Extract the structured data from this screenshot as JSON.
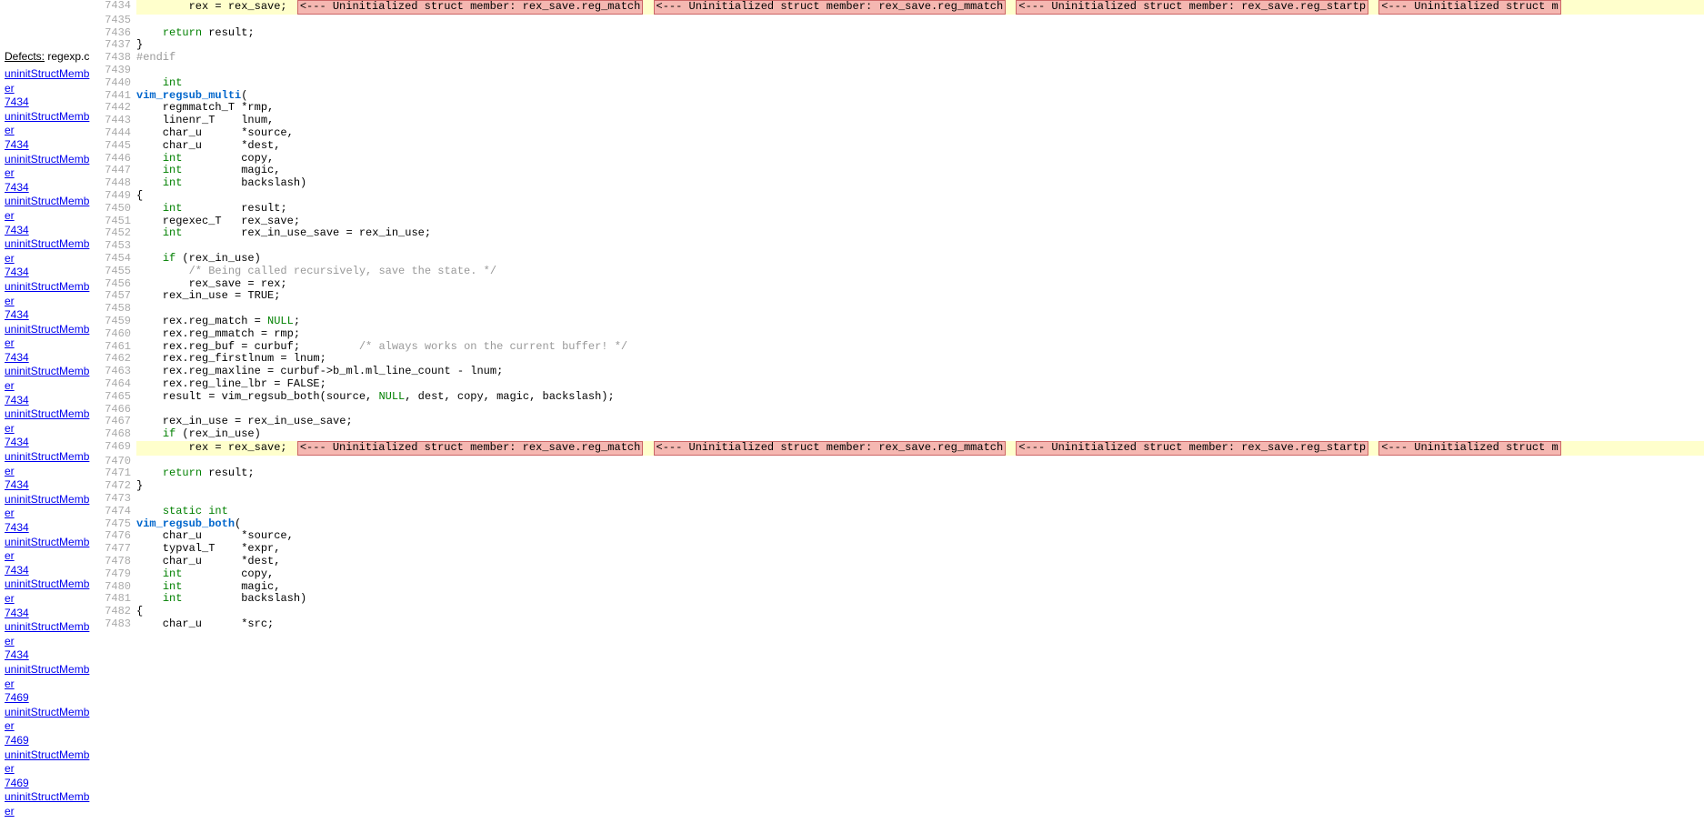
{
  "sidebar": {
    "title_label": "Defects:",
    "title_file": "regexp.c",
    "defects": [
      {
        "name": "uninitStructMember",
        "line": "7434"
      },
      {
        "name": "uninitStructMember",
        "line": "7434"
      },
      {
        "name": "uninitStructMember",
        "line": "7434"
      },
      {
        "name": "uninitStructMember",
        "line": "7434"
      },
      {
        "name": "uninitStructMember",
        "line": "7434"
      },
      {
        "name": "uninitStructMember",
        "line": "7434"
      },
      {
        "name": "uninitStructMember",
        "line": "7434"
      },
      {
        "name": "uninitStructMember",
        "line": "7434"
      },
      {
        "name": "uninitStructMember",
        "line": "7434"
      },
      {
        "name": "uninitStructMember",
        "line": "7434"
      },
      {
        "name": "uninitStructMember",
        "line": "7434"
      },
      {
        "name": "uninitStructMember",
        "line": "7434"
      },
      {
        "name": "uninitStructMember",
        "line": "7434"
      },
      {
        "name": "uninitStructMember",
        "line": "7434"
      },
      {
        "name": "uninitStructMember",
        "line": "7469"
      },
      {
        "name": "uninitStructMember",
        "line": "7469"
      },
      {
        "name": "uninitStructMember",
        "line": "7469"
      },
      {
        "name": "uninitStructMember",
        "line": ""
      }
    ]
  },
  "warnings": {
    "w1": "<--- Uninitialized struct member: rex_save.reg_match",
    "w2": "<--- Uninitialized struct member: rex_save.reg_mmatch",
    "w3": "<--- Uninitialized struct member: rex_save.reg_startp",
    "w4": "<--- Uninitialized struct m"
  },
  "lines": [
    {
      "n": "7434",
      "hl": true,
      "warn": true,
      "tokens": [
        {
          "t": "        rex = rex_save;"
        }
      ]
    },
    {
      "n": "7435",
      "tokens": []
    },
    {
      "n": "7436",
      "tokens": [
        {
          "t": "    "
        },
        {
          "t": "return",
          "c": "kw"
        },
        {
          "t": " result;"
        }
      ]
    },
    {
      "n": "7437",
      "tokens": [
        {
          "t": "}"
        }
      ]
    },
    {
      "n": "7438",
      "tokens": [
        {
          "t": "#endif",
          "c": "pp"
        }
      ]
    },
    {
      "n": "7439",
      "tokens": []
    },
    {
      "n": "7440",
      "tokens": [
        {
          "t": "    "
        },
        {
          "t": "int",
          "c": "kw"
        }
      ]
    },
    {
      "n": "7441",
      "tokens": [
        {
          "t": "vim_regsub_multi",
          "c": "fn"
        },
        {
          "t": "("
        }
      ]
    },
    {
      "n": "7442",
      "tokens": [
        {
          "t": "    regmmatch_T *rmp,"
        }
      ]
    },
    {
      "n": "7443",
      "tokens": [
        {
          "t": "    linenr_T    lnum,"
        }
      ]
    },
    {
      "n": "7444",
      "tokens": [
        {
          "t": "    char_u      *source,"
        }
      ]
    },
    {
      "n": "7445",
      "tokens": [
        {
          "t": "    char_u      *dest,"
        }
      ]
    },
    {
      "n": "7446",
      "tokens": [
        {
          "t": "    "
        },
        {
          "t": "int",
          "c": "kw"
        },
        {
          "t": "         copy,"
        }
      ]
    },
    {
      "n": "7447",
      "tokens": [
        {
          "t": "    "
        },
        {
          "t": "int",
          "c": "kw"
        },
        {
          "t": "         magic,"
        }
      ]
    },
    {
      "n": "7448",
      "tokens": [
        {
          "t": "    "
        },
        {
          "t": "int",
          "c": "kw"
        },
        {
          "t": "         backslash)"
        }
      ]
    },
    {
      "n": "7449",
      "tokens": [
        {
          "t": "{"
        }
      ]
    },
    {
      "n": "7450",
      "tokens": [
        {
          "t": "    "
        },
        {
          "t": "int",
          "c": "kw"
        },
        {
          "t": "         result;"
        }
      ]
    },
    {
      "n": "7451",
      "tokens": [
        {
          "t": "    regexec_T   rex_save;"
        }
      ]
    },
    {
      "n": "7452",
      "tokens": [
        {
          "t": "    "
        },
        {
          "t": "int",
          "c": "kw"
        },
        {
          "t": "         rex_in_use_save = rex_in_use;"
        }
      ]
    },
    {
      "n": "7453",
      "tokens": []
    },
    {
      "n": "7454",
      "tokens": [
        {
          "t": "    "
        },
        {
          "t": "if",
          "c": "kw"
        },
        {
          "t": " (rex_in_use)"
        }
      ]
    },
    {
      "n": "7455",
      "tokens": [
        {
          "t": "        "
        },
        {
          "t": "/* Being called recursively, save the state. */",
          "c": "cmt"
        }
      ]
    },
    {
      "n": "7456",
      "tokens": [
        {
          "t": "        rex_save = rex;"
        }
      ]
    },
    {
      "n": "7457",
      "tokens": [
        {
          "t": "    rex_in_use = TRUE;"
        }
      ]
    },
    {
      "n": "7458",
      "tokens": []
    },
    {
      "n": "7459",
      "tokens": [
        {
          "t": "    rex.reg_match = "
        },
        {
          "t": "NULL",
          "c": "kw"
        },
        {
          "t": ";"
        }
      ]
    },
    {
      "n": "7460",
      "tokens": [
        {
          "t": "    rex.reg_mmatch = rmp;"
        }
      ]
    },
    {
      "n": "7461",
      "tokens": [
        {
          "t": "    rex.reg_buf = curbuf;         "
        },
        {
          "t": "/* always works on the current buffer! */",
          "c": "cmt"
        }
      ]
    },
    {
      "n": "7462",
      "tokens": [
        {
          "t": "    rex.reg_firstlnum = lnum;"
        }
      ]
    },
    {
      "n": "7463",
      "tokens": [
        {
          "t": "    rex.reg_maxline = curbuf->b_ml.ml_line_count - lnum;"
        }
      ]
    },
    {
      "n": "7464",
      "tokens": [
        {
          "t": "    rex.reg_line_lbr = FALSE;"
        }
      ]
    },
    {
      "n": "7465",
      "tokens": [
        {
          "t": "    result = vim_regsub_both(source, "
        },
        {
          "t": "NULL",
          "c": "kw"
        },
        {
          "t": ", dest, copy, magic, backslash);"
        }
      ]
    },
    {
      "n": "7466",
      "tokens": []
    },
    {
      "n": "7467",
      "tokens": [
        {
          "t": "    rex_in_use = rex_in_use_save;"
        }
      ]
    },
    {
      "n": "7468",
      "tokens": [
        {
          "t": "    "
        },
        {
          "t": "if",
          "c": "kw"
        },
        {
          "t": " (rex_in_use)"
        }
      ]
    },
    {
      "n": "7469",
      "hl": true,
      "warn": true,
      "tokens": [
        {
          "t": "        rex = rex_save;"
        }
      ]
    },
    {
      "n": "7470",
      "tokens": []
    },
    {
      "n": "7471",
      "tokens": [
        {
          "t": "    "
        },
        {
          "t": "return",
          "c": "kw"
        },
        {
          "t": " result;"
        }
      ]
    },
    {
      "n": "7472",
      "tokens": [
        {
          "t": "}"
        }
      ]
    },
    {
      "n": "7473",
      "tokens": []
    },
    {
      "n": "7474",
      "tokens": [
        {
          "t": "    "
        },
        {
          "t": "static",
          "c": "kw"
        },
        {
          "t": " "
        },
        {
          "t": "int",
          "c": "kw"
        }
      ]
    },
    {
      "n": "7475",
      "tokens": [
        {
          "t": "vim_regsub_both",
          "c": "fn"
        },
        {
          "t": "("
        }
      ]
    },
    {
      "n": "7476",
      "tokens": [
        {
          "t": "    char_u      *source,"
        }
      ]
    },
    {
      "n": "7477",
      "tokens": [
        {
          "t": "    typval_T    *expr,"
        }
      ]
    },
    {
      "n": "7478",
      "tokens": [
        {
          "t": "    char_u      *dest,"
        }
      ]
    },
    {
      "n": "7479",
      "tokens": [
        {
          "t": "    "
        },
        {
          "t": "int",
          "c": "kw"
        },
        {
          "t": "         copy,"
        }
      ]
    },
    {
      "n": "7480",
      "tokens": [
        {
          "t": "    "
        },
        {
          "t": "int",
          "c": "kw"
        },
        {
          "t": "         magic,"
        }
      ]
    },
    {
      "n": "7481",
      "tokens": [
        {
          "t": "    "
        },
        {
          "t": "int",
          "c": "kw"
        },
        {
          "t": "         backslash)"
        }
      ]
    },
    {
      "n": "7482",
      "tokens": [
        {
          "t": "{"
        }
      ]
    },
    {
      "n": "7483",
      "tokens": [
        {
          "t": "    char_u      *src;"
        }
      ]
    }
  ]
}
